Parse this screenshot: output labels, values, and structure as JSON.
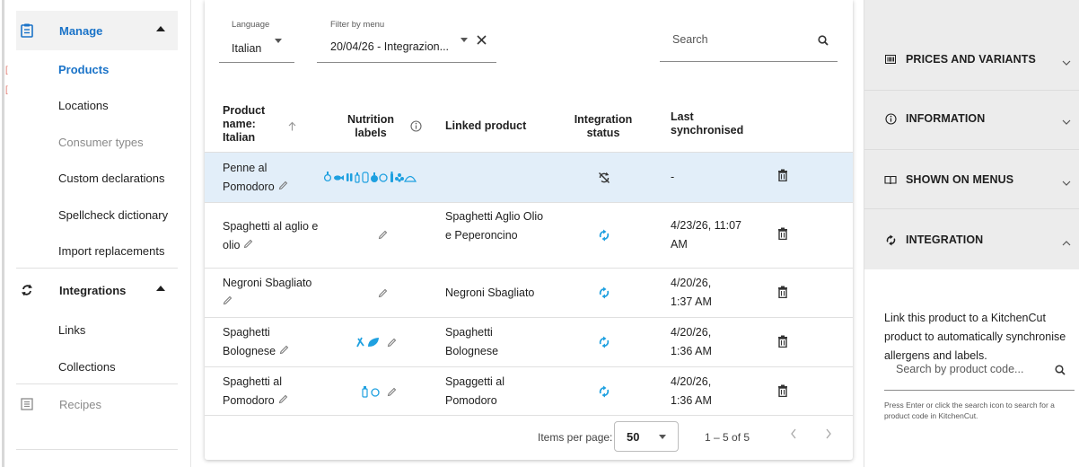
{
  "sidebar": {
    "manage_label": "Manage",
    "manage_items": [
      "Products",
      "Locations",
      "Consumer types",
      "Custom declarations",
      "Spellcheck dictionary",
      "Import replacements"
    ],
    "integrations_label": "Integrations",
    "integrations_items": [
      "Links",
      "Collections"
    ],
    "recipes_label": "Recipes"
  },
  "filters": {
    "language_label": "Language",
    "language_value": "Italian",
    "menu_label": "Filter by menu",
    "menu_value": "20/04/26 - Integrazion...",
    "search_placeholder": "Search"
  },
  "table": {
    "headers": {
      "product": "Product name: Italian",
      "nutrition": "Nutrition labels",
      "linked": "Linked product",
      "status": "Integration status",
      "synced": "Last synchronised"
    },
    "rows": [
      {
        "name": "Penne al Pomodoro",
        "linked": "",
        "synced": "-",
        "status_icon": "sync-disabled-icon",
        "labels": [
          "allergen-icons"
        ]
      },
      {
        "name": "Spaghetti al aglio e olio",
        "linked": "Spaghetti Aglio Olio e Peperoncino",
        "synced": "4/23/26, 11:07 AM",
        "status_icon": "sync-icon"
      },
      {
        "name": "Negroni Sbagliato",
        "linked": "Negroni Sbagliato",
        "synced": "4/20/26, 1:37 AM",
        "status_icon": "sync-icon"
      },
      {
        "name": "Spaghetti Bolognese",
        "linked": "Spaghetti Bolognese",
        "synced": "4/20/26, 1:36 AM",
        "status_icon": "sync-icon"
      },
      {
        "name": "Spaghetti al Pomodoro",
        "linked": "Spaggetti al Pomodoro",
        "synced": "4/20/26, 1:36 AM",
        "status_icon": "sync-icon"
      }
    ]
  },
  "paginator": {
    "items_per_page_label": "Items per page:",
    "page_size": "50",
    "range": "1 – 5 of 5"
  },
  "panel": {
    "sections": [
      "PRICES AND VARIANTS",
      "INFORMATION",
      "SHOWN ON MENUS",
      "INTEGRATION"
    ],
    "description": "Link this product to a KitchenCut product to automatically synchronise allergens and labels.",
    "search_placeholder": "Search by product code...",
    "hint": "Press Enter or click the search icon to search for a product code in KitchenCut."
  },
  "colors": {
    "accent": "#1a73c8",
    "icon_blue": "#1ea0e0",
    "selected_row": "#e2eef9",
    "panel_gray": "#ececec"
  }
}
